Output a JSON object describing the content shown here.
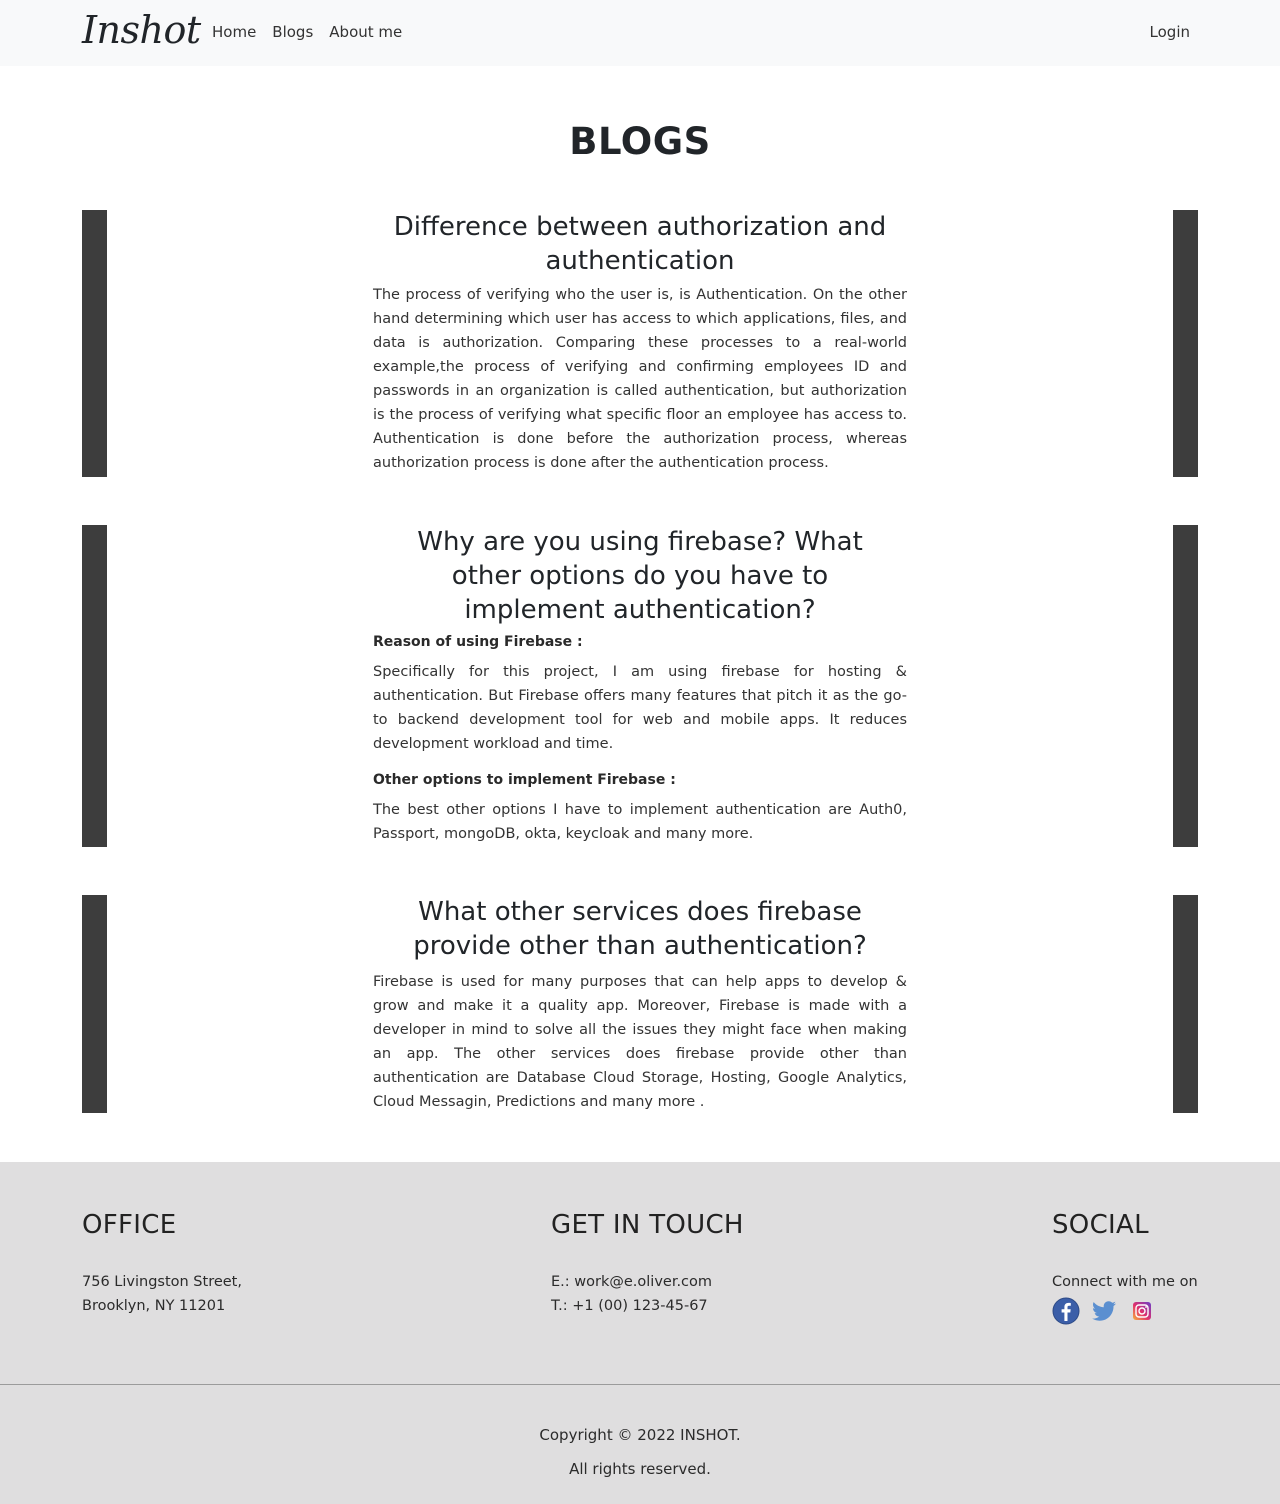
{
  "navbar": {
    "brand": "Inshot",
    "links": [
      "Home",
      "Blogs",
      "About me"
    ],
    "login": "Login"
  },
  "main": {
    "title": "BLOGS",
    "blogs": [
      {
        "title": "Difference between authorization and authentication",
        "body": "The process of verifying who the user is, is Authentication. On the other hand determining which user has access to which applications, files, and data is authorization. Comparing these processes to a real-world example,the process of verifying and confirming employees ID and passwords in an organization is called authentication, but authorization is the process of verifying what specific floor an employee has access to. Authentication is done before the authorization process, whereas authorization process is done after the authentication process."
      },
      {
        "title": "Why are you using firebase? What other options do you have to implement authentication?",
        "sub1": "Reason of using Firebase :",
        "body1": "Specifically for this project, I am using firebase for hosting & authentication. But Firebase offers many features that pitch it as the go-to backend development tool for web and mobile apps. It reduces development workload and time.",
        "sub2": "Other options to implement Firebase :",
        "body2": "The best other options I have to implement authentication are Auth0, Passport, mongoDB, okta, keycloak and many more."
      },
      {
        "title": "What other services does firebase provide other than authentication?",
        "body": "Firebase is used for many purposes that can help apps to develop & grow and make it a quality app. Moreover, Firebase is made with a developer in mind to solve all the issues they might face when making an app. The other services does firebase provide other than authentication are Database Cloud Storage, Hosting, Google Analytics, Cloud Messagin, Predictions and many more ."
      }
    ]
  },
  "footer": {
    "office": {
      "heading": "OFFICE",
      "line1": "756 Livingston Street,",
      "line2": "Brooklyn, NY 11201"
    },
    "contact": {
      "heading": "GET IN TOUCH",
      "email": "E.: work@e.oliver.com",
      "phone": "T.: +1 (00) 123-45-67"
    },
    "social": {
      "heading": "SOCIAL",
      "text": "Connect with me on",
      "icons": [
        "facebook-icon",
        "twitter-icon",
        "instagram-icon"
      ]
    },
    "copyright": "Copyright © 2022 INSHOT.",
    "rights": "All rights reserved."
  },
  "colors": {
    "navbar_bg": "#f8f9fa",
    "bar": "#3d3d3d",
    "footer_bg": "#dfdedf"
  }
}
